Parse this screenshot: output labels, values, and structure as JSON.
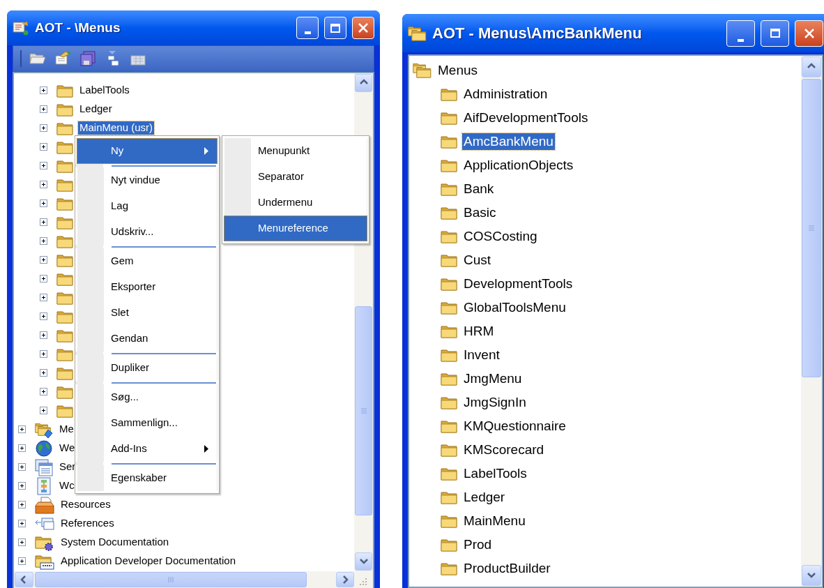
{
  "windows": [
    {
      "title": "AOT - \\Menus",
      "tree": [
        {
          "children": [
            {
              "label": "LabelTools",
              "kind": "folder",
              "expandable": true,
              "selected": false
            },
            {
              "label": "Ledger",
              "kind": "folder",
              "expandable": true,
              "selected": false
            },
            {
              "label": "MainMenu (usr)",
              "kind": "folder",
              "expandable": true,
              "selected": true
            },
            {
              "kind": "folder",
              "expandable": true,
              "selected": false
            },
            {
              "kind": "folder",
              "expandable": true,
              "selected": false
            },
            {
              "kind": "folder",
              "expandable": true,
              "selected": false
            },
            {
              "kind": "folder",
              "expandable": true,
              "selected": false
            },
            {
              "kind": "folder",
              "expandable": true,
              "selected": false
            },
            {
              "kind": "folder",
              "expandable": true,
              "selected": false
            },
            {
              "kind": "folder",
              "expandable": true,
              "selected": false
            },
            {
              "kind": "folder",
              "expandable": true,
              "selected": false
            },
            {
              "kind": "folder",
              "expandable": true,
              "selected": false
            },
            {
              "kind": "folder",
              "expandable": true,
              "selected": false
            },
            {
              "kind": "folder",
              "expandable": true,
              "selected": false
            },
            {
              "kind": "folder",
              "expandable": true,
              "selected": false
            },
            {
              "kind": "folder",
              "expandable": true,
              "selected": false
            },
            {
              "kind": "folder",
              "expandable": true,
              "selected": false
            },
            {
              "kind": "folder",
              "expandable": true,
              "selected": false
            }
          ]
        },
        {
          "label": "Me",
          "kind": "menu-items",
          "expandable": true,
          "selected": false
        },
        {
          "label": "We",
          "kind": "web",
          "expandable": true,
          "selected": false
        },
        {
          "label": "Ser",
          "kind": "services",
          "expandable": true,
          "selected": false
        },
        {
          "label": "Wc",
          "kind": "workflow",
          "expandable": true,
          "selected": false
        },
        {
          "label": "Resources",
          "kind": "resources",
          "expandable": true,
          "selected": false
        },
        {
          "label": "References",
          "kind": "references",
          "expandable": true,
          "selected": false
        },
        {
          "label": "System Documentation",
          "kind": "system-docs",
          "expandable": true,
          "selected": false
        },
        {
          "label": "Application Developer Documentation",
          "kind": "app-docs",
          "expandable": true,
          "selected": false
        }
      ],
      "context_menu": [
        {
          "kind": "item",
          "label": "Ny",
          "submenu": true,
          "selected": true
        },
        {
          "kind": "separator"
        },
        {
          "kind": "item",
          "label": "Nyt vindue",
          "selected": false
        },
        {
          "kind": "item",
          "label": "Lag",
          "selected": false
        },
        {
          "kind": "item",
          "label": "Udskriv...",
          "selected": false
        },
        {
          "kind": "separator"
        },
        {
          "kind": "item",
          "label": "Gem",
          "selected": false
        },
        {
          "kind": "item",
          "label": "Eksporter",
          "selected": false
        },
        {
          "kind": "item",
          "label": "Slet",
          "selected": false
        },
        {
          "kind": "item",
          "label": "Gendan",
          "selected": false
        },
        {
          "kind": "separator"
        },
        {
          "kind": "item",
          "label": "Dupliker",
          "selected": false
        },
        {
          "kind": "separator"
        },
        {
          "kind": "item",
          "label": "Søg...",
          "selected": false
        },
        {
          "kind": "item",
          "label": "Sammenlign...",
          "selected": false
        },
        {
          "kind": "item",
          "label": "Add-Ins",
          "submenu": true,
          "selected": false
        },
        {
          "kind": "separator"
        },
        {
          "kind": "item",
          "label": "Egenskaber",
          "selected": false
        }
      ],
      "submenu": [
        {
          "kind": "item",
          "label": "Menupunkt",
          "selected": false
        },
        {
          "kind": "item",
          "label": "Separator",
          "selected": false
        },
        {
          "kind": "item",
          "label": "Undermenu",
          "selected": false
        },
        {
          "kind": "item",
          "label": "Menureference",
          "selected": true
        }
      ]
    },
    {
      "title": "AOT - Menus\\AmcBankMenu",
      "tree": [
        {
          "label": "Menus",
          "kind": "menus-root",
          "selected": false,
          "children": [
            {
              "label": "Administration",
              "kind": "folder",
              "selected": false
            },
            {
              "label": "AifDevelopmentTools",
              "kind": "folder",
              "selected": false
            },
            {
              "label": "AmcBankMenu",
              "kind": "folder",
              "selected": true
            },
            {
              "label": "ApplicationObjects",
              "kind": "folder",
              "selected": false
            },
            {
              "label": "Bank",
              "kind": "folder",
              "selected": false
            },
            {
              "label": "Basic",
              "kind": "folder",
              "selected": false
            },
            {
              "label": "COSCosting",
              "kind": "folder",
              "selected": false
            },
            {
              "label": "Cust",
              "kind": "folder",
              "selected": false
            },
            {
              "label": "DevelopmentTools",
              "kind": "folder",
              "selected": false
            },
            {
              "label": "GlobalToolsMenu",
              "kind": "folder",
              "selected": false
            },
            {
              "label": "HRM",
              "kind": "folder",
              "selected": false
            },
            {
              "label": "Invent",
              "kind": "folder",
              "selected": false
            },
            {
              "label": "JmgMenu",
              "kind": "folder",
              "selected": false
            },
            {
              "label": "JmgSignIn",
              "kind": "folder",
              "selected": false
            },
            {
              "label": "KMQuestionnaire",
              "kind": "folder",
              "selected": false
            },
            {
              "label": "KMScorecard",
              "kind": "folder",
              "selected": false
            },
            {
              "label": "LabelTools",
              "kind": "folder",
              "selected": false
            },
            {
              "label": "Ledger",
              "kind": "folder",
              "selected": false
            },
            {
              "label": "MainMenu",
              "kind": "folder",
              "selected": false
            },
            {
              "label": "Prod",
              "kind": "folder",
              "selected": false
            },
            {
              "label": "ProductBuilder",
              "kind": "folder",
              "selected": false
            }
          ]
        }
      ]
    }
  ]
}
